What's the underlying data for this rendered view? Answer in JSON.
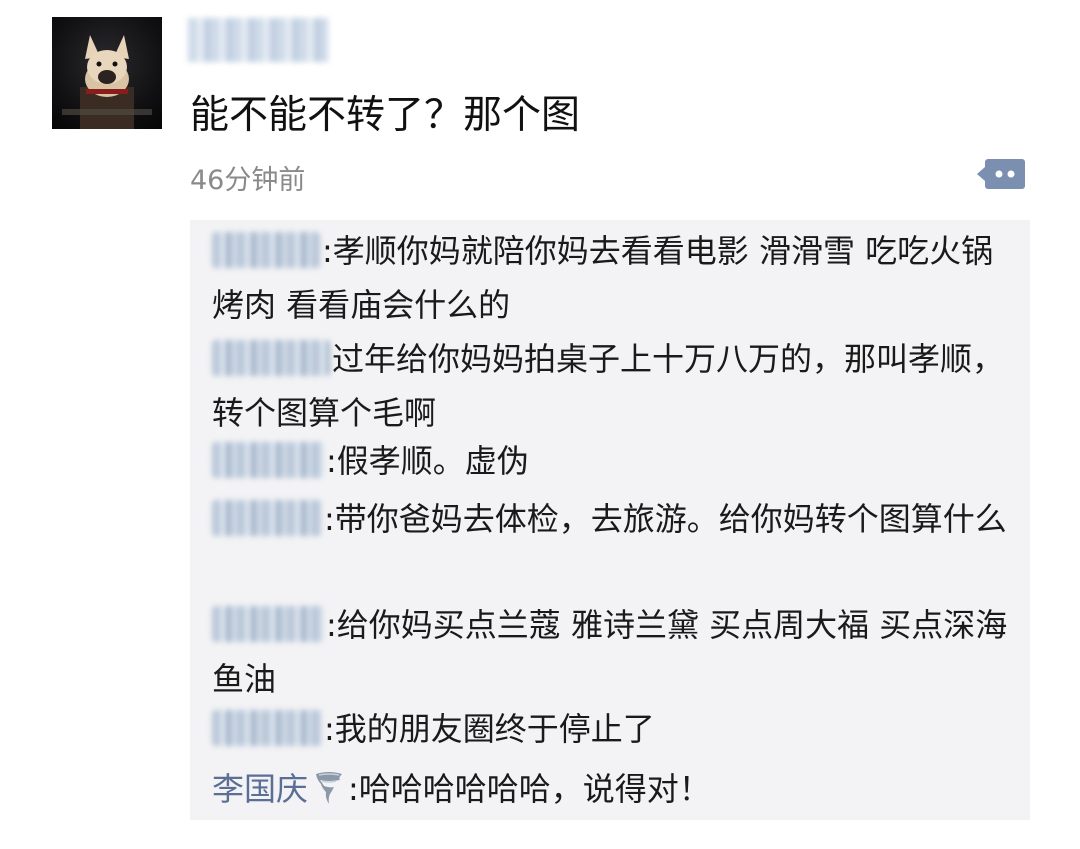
{
  "post": {
    "text": "能不能不转了？那个图",
    "time": "46分钟前"
  },
  "comments": [
    {
      "text": "孝顺你妈就陪你妈去看看电影 滑滑雪 吃吃火锅烤肉 看看庙会什么的"
    },
    {
      "text": "过年给你妈妈拍桌子上十万八万的，那叫孝顺，转个图算个毛啊"
    },
    {
      "text": "假孝顺。虚伪"
    },
    {
      "text": "带你爸妈去体检，去旅游。给你妈转个图算什么"
    },
    {
      "text": "给你妈买点兰蔻 雅诗兰黛 买点周大福 买点深海鱼油"
    },
    {
      "text": "我的朋友圈终于停止了"
    },
    {
      "name": "李国庆",
      "text": "哈哈哈哈哈哈，说得对！"
    }
  ],
  "colors": {
    "link": "#5a6e96",
    "comment_bg": "#f3f3f5",
    "time": "#8a8a8a"
  },
  "icons": [
    "dog-avatar",
    "comment-action-icon",
    "tornado-emoji"
  ]
}
